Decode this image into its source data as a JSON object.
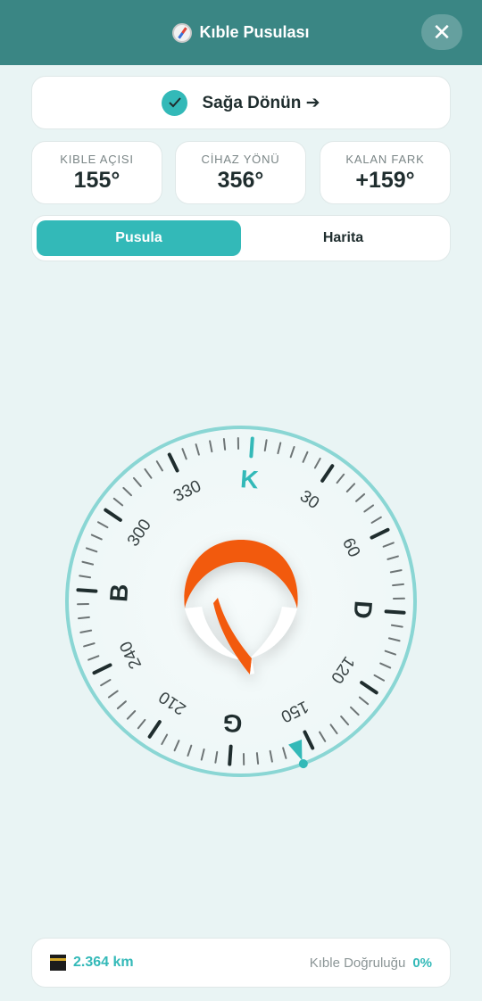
{
  "header": {
    "title": "Kıble Pusulası",
    "close_label": "✕"
  },
  "turn_hint": {
    "text": "Sağa Dönün ➔"
  },
  "stats": [
    {
      "label": "KIBLE AÇISI",
      "value": "155°"
    },
    {
      "label": "CİHAZ YÖNÜ",
      "value": "356°"
    },
    {
      "label": "KALAN FARK",
      "value": "+159°"
    }
  ],
  "tabs": [
    {
      "label": "Pusula",
      "active": true
    },
    {
      "label": "Harita",
      "active": false
    }
  ],
  "compass": {
    "cardinals": {
      "north": "K",
      "east": "D",
      "south": "G",
      "west": "B"
    },
    "degree_labels": [
      "30",
      "60",
      "120",
      "150",
      "210",
      "240",
      "300",
      "330"
    ],
    "qibla_bearing_deg": 155,
    "device_heading_deg": 356
  },
  "footer": {
    "distance": "2.364 km",
    "accuracy_label": "Kıble Doğruluğu",
    "accuracy_value": "0%"
  },
  "colors": {
    "header": "#3a8684",
    "accent": "#33b9b8",
    "needle": "#f25a0f",
    "background": "#e9f4f4"
  }
}
